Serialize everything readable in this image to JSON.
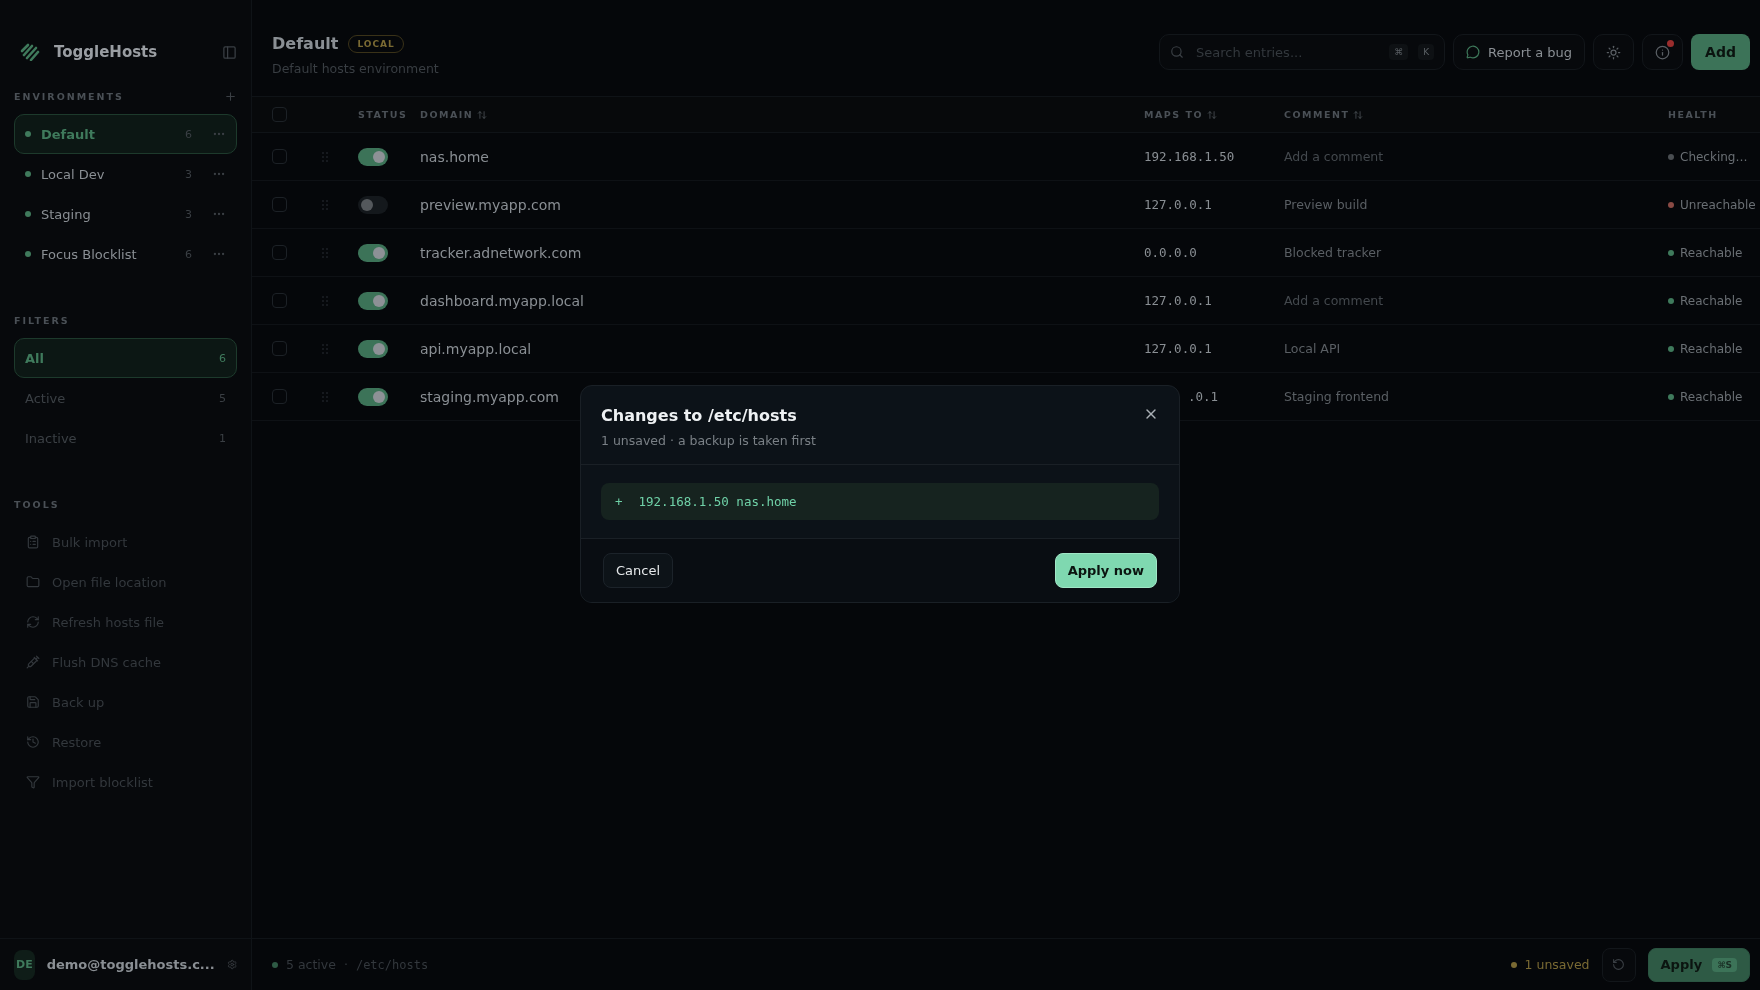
{
  "app": {
    "name": "ToggleHosts"
  },
  "sidebar": {
    "environments_title": "ENVIRONMENTS",
    "environments": [
      {
        "name": "Default",
        "count": "6",
        "color": "#3f7a5c",
        "selected": true
      },
      {
        "name": "Local Dev",
        "count": "3",
        "color": "#3f7a5c",
        "selected": false
      },
      {
        "name": "Staging",
        "count": "3",
        "color": "#3f7a5c",
        "selected": false
      },
      {
        "name": "Focus Blocklist",
        "count": "6",
        "color": "#3f7a5c",
        "selected": false
      }
    ],
    "filters_title": "FILTERS",
    "filters": [
      {
        "label": "All",
        "count": "6",
        "selected": true
      },
      {
        "label": "Active",
        "count": "5",
        "selected": false
      },
      {
        "label": "Inactive",
        "count": "1",
        "selected": false
      }
    ],
    "tools_title": "TOOLS",
    "tools": [
      {
        "label": "Bulk import",
        "kind": "clipboard"
      },
      {
        "label": "Open file location",
        "kind": "folder"
      },
      {
        "label": "Refresh hosts file",
        "kind": "refresh"
      },
      {
        "label": "Flush DNS cache",
        "kind": "syringe"
      },
      {
        "label": "Back up",
        "kind": "save"
      },
      {
        "label": "Restore",
        "kind": "history"
      },
      {
        "label": "Import blocklist",
        "kind": "filter"
      }
    ],
    "user": {
      "initials": "DE",
      "email": "demo@togglehosts.c..."
    }
  },
  "header": {
    "title": "Default",
    "badge": "LOCAL",
    "subtitle": "Default hosts environment",
    "search": {
      "placeholder": "Search entries...",
      "keys": [
        "⌘",
        "K"
      ]
    },
    "report_button": "Report a bug",
    "notification": true,
    "add_button": "Add"
  },
  "table": {
    "select_all_checked": false,
    "columns": {
      "status": "STATUS",
      "domain": "DOMAIN",
      "maps_to": "MAPS TO",
      "comment": "COMMENT",
      "health": "HEALTH"
    },
    "rows": [
      {
        "checked": false,
        "on": true,
        "domain": "nas.home",
        "maps_to": "192.168.1.50",
        "comment_placeholder": "Add a comment",
        "health": {
          "label": "Checking…",
          "color": "#4a4e52"
        }
      },
      {
        "checked": false,
        "on": false,
        "domain": "preview.myapp.com",
        "maps_to": "127.0.0.1",
        "comment": "Preview build",
        "health": {
          "label": "Unreachable",
          "color": "#8a4a44"
        }
      },
      {
        "checked": false,
        "on": true,
        "domain": "tracker.adnetwork.com",
        "maps_to": "0.0.0.0",
        "comment": "Blocked tracker",
        "health": {
          "label": "Reachable",
          "color": "#3f7a5c"
        }
      },
      {
        "checked": false,
        "on": true,
        "domain": "dashboard.myapp.local",
        "maps_to": "127.0.0.1",
        "comment_placeholder": "Add a comment",
        "health": {
          "label": "Reachable",
          "color": "#3f7a5c"
        }
      },
      {
        "checked": false,
        "on": true,
        "domain": "api.myapp.local",
        "maps_to": "127.0.0.1",
        "comment": "Local API",
        "health": {
          "label": "Reachable",
          "color": "#3f7a5c"
        }
      },
      {
        "checked": false,
        "on": true,
        "domain": "staging.myapp.com",
        "maps_to": ".0.1",
        "maps_to_covered": true,
        "comment": "Staging frontend",
        "health": {
          "label": "Reachable",
          "color": "#3f7a5c"
        }
      }
    ]
  },
  "status_bar": {
    "active": "5 active",
    "separator": "·",
    "path": "/etc/hosts",
    "unsaved": "1 unsaved",
    "apply_button": "Apply",
    "apply_key": "⌘S"
  },
  "dialog": {
    "title": "Changes to /etc/hosts",
    "subtitle": "1 unsaved · a backup is taken first",
    "diff": [
      {
        "sign": "+",
        "line": "192.168.1.50 nas.home"
      }
    ],
    "cancel_button": "Cancel",
    "confirm_button": "Apply now"
  }
}
